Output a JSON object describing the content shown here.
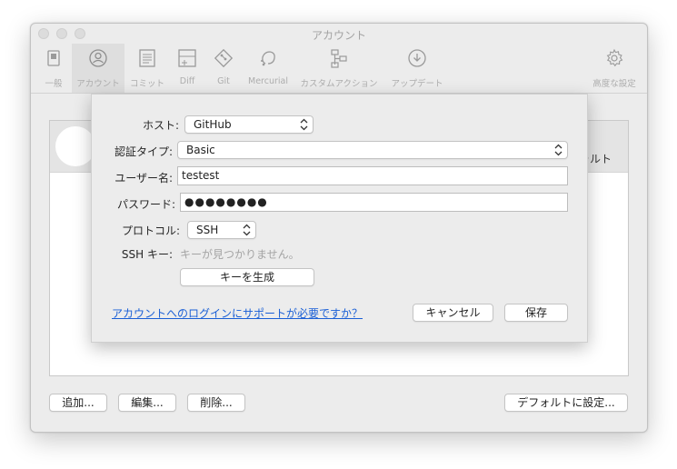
{
  "window": {
    "title": "アカウント"
  },
  "toolbar": {
    "items": [
      {
        "label": "一般",
        "icon": "switch-icon"
      },
      {
        "label": "アカウント",
        "icon": "account-icon"
      },
      {
        "label": "コミット",
        "icon": "document-icon"
      },
      {
        "label": "Diff",
        "icon": "diff-icon"
      },
      {
        "label": "Git",
        "icon": "git-icon"
      },
      {
        "label": "Mercurial",
        "icon": "mercurial-icon"
      },
      {
        "label": "カスタムアクション",
        "icon": "flow-icon"
      },
      {
        "label": "アップデート",
        "icon": "download-icon"
      },
      {
        "label": "高度な設定",
        "icon": "gear-icon"
      }
    ],
    "active_index": 1
  },
  "accounts_panel": {
    "default_column_partial": "ォルト"
  },
  "bottom_buttons": {
    "add": "追加...",
    "edit": "編集...",
    "delete": "削除...",
    "set_default": "デフォルトに設定..."
  },
  "sheet": {
    "host_label": "ホスト:",
    "host_value": "GitHub",
    "auth_type_label": "認証タイプ:",
    "auth_type_value": "Basic",
    "username_label": "ユーザー名:",
    "username_value": "testest",
    "password_label": "パスワード:",
    "password_value": "●●●●●●●●",
    "protocol_label": "プロトコル:",
    "protocol_value": "SSH",
    "ssh_key_label": "SSH キー:",
    "ssh_key_value": "キーが見つかりません。",
    "generate_key_button": "キーを生成",
    "help_link": "アカウントへのログインにサポートが必要ですか？",
    "cancel_button": "キャンセル",
    "save_button": "保存"
  }
}
